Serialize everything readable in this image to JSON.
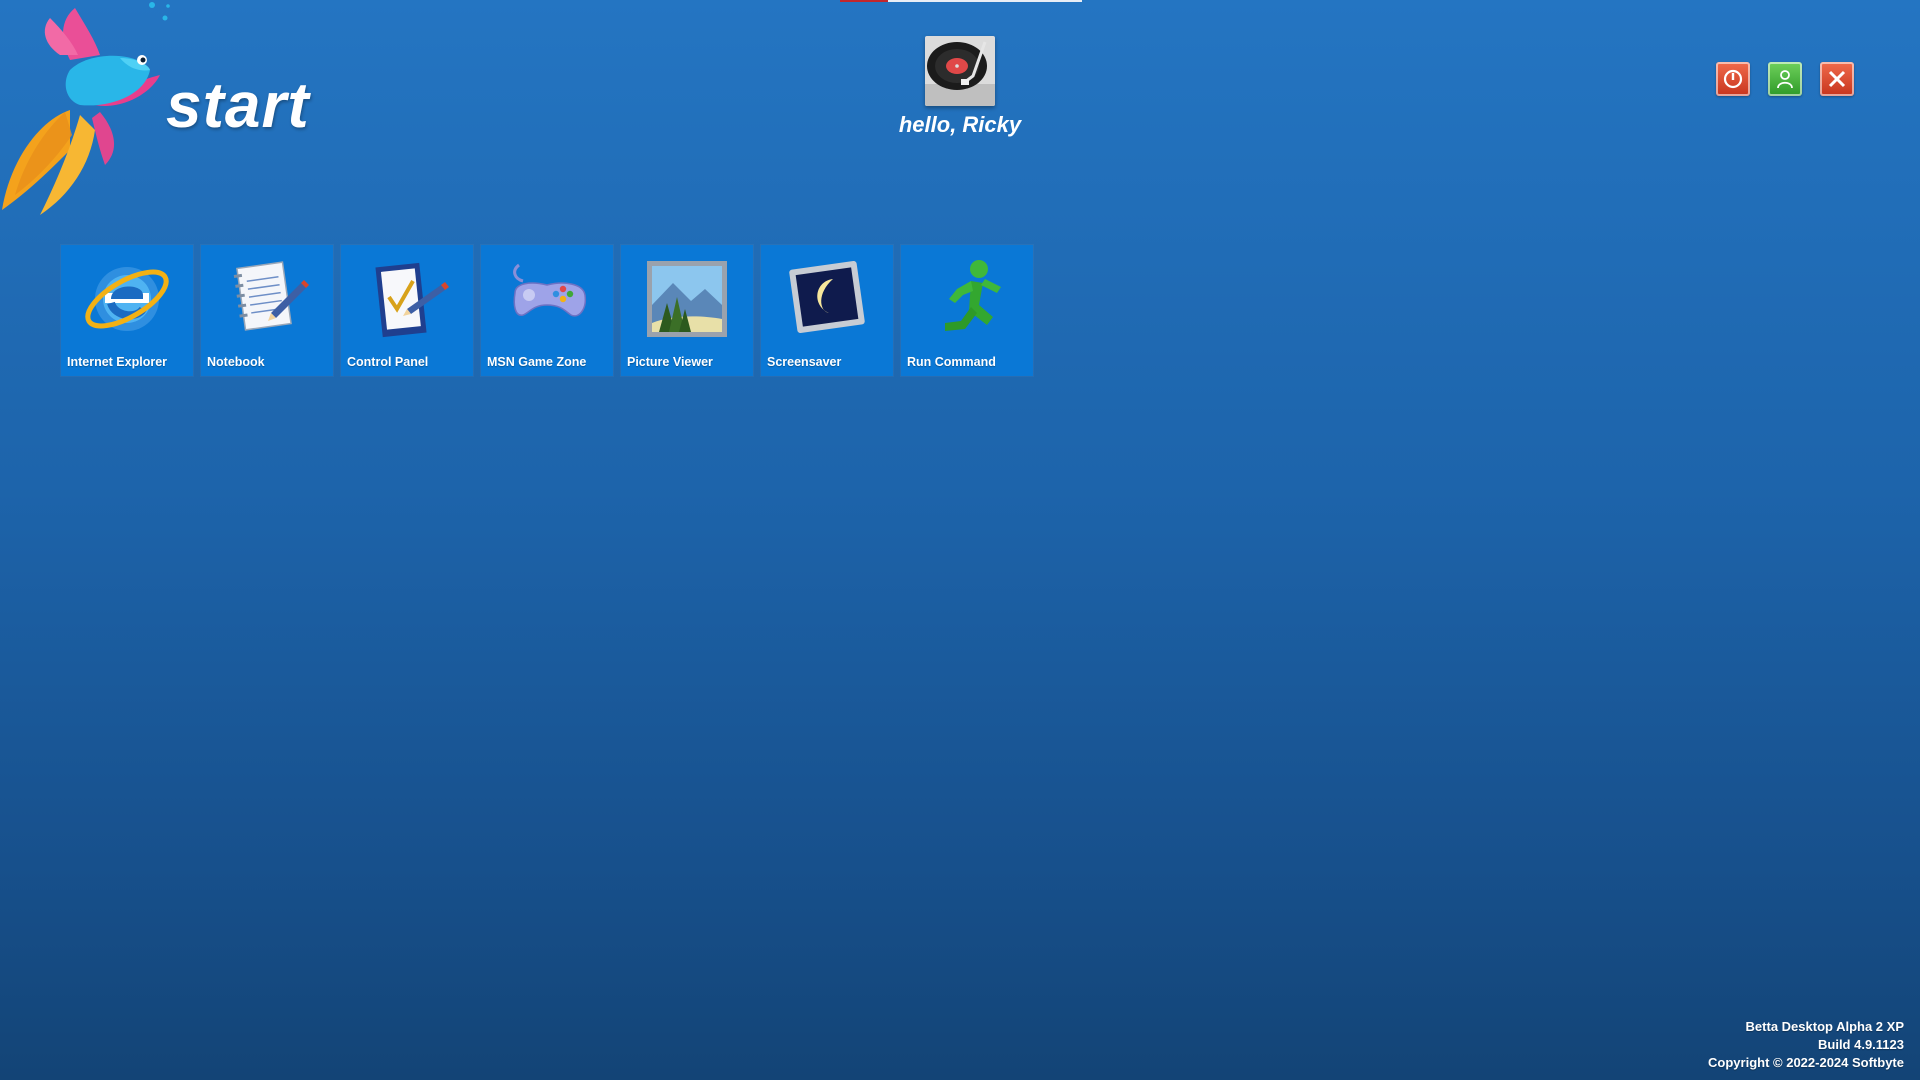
{
  "header": {
    "title": "start",
    "greeting": "hello, Ricky"
  },
  "loading_bar": {
    "progress": 0.2
  },
  "session_buttons": [
    {
      "name": "shutdown",
      "icon": "power-icon",
      "color": "#d9452a"
    },
    {
      "name": "switch-user",
      "icon": "user-icon",
      "color": "#3fa837"
    },
    {
      "name": "close",
      "icon": "close-icon",
      "color": "#d9452a"
    }
  ],
  "apps": [
    {
      "label": "Internet Explorer",
      "icon": "internet-explorer-icon"
    },
    {
      "label": "Notebook",
      "icon": "notebook-icon"
    },
    {
      "label": "Control Panel",
      "icon": "control-panel-icon"
    },
    {
      "label": "MSN Game Zone",
      "icon": "gamepad-icon"
    },
    {
      "label": "Picture Viewer",
      "icon": "picture-icon"
    },
    {
      "label": "Screensaver",
      "icon": "moon-monitor-icon"
    },
    {
      "label": "Run Command",
      "icon": "running-man-icon"
    }
  ],
  "footer": {
    "product": "Betta Desktop Alpha 2 XP",
    "build": "Build 4.9.1123",
    "copyright": "Copyright © 2022-2024 Softbyte"
  },
  "colors": {
    "background_top": "#2475c2",
    "background_bottom": "#134476",
    "tile": "#0a78d6"
  }
}
